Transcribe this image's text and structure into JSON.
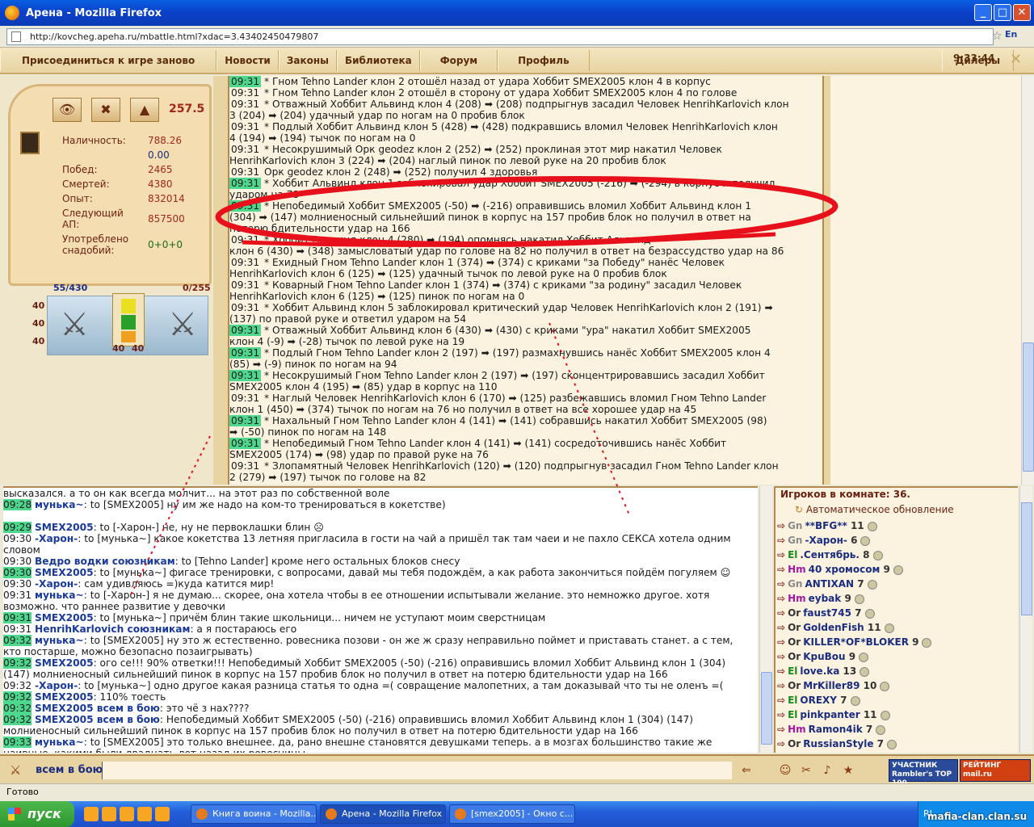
{
  "window": {
    "title": "Арена - Mozilla Firefox",
    "url": "http://kovcheg.apeha.ru/mbattle.html?xdac=3.43402450479807",
    "lang": "En"
  },
  "menu": {
    "items": [
      "Присоединиться к игре заново",
      "Новости",
      "Законы",
      "Библиотека",
      "Форум",
      "Профиль",
      "Дилеры"
    ],
    "time": "9:33:44"
  },
  "stats": {
    "score": "257.5",
    "rows": [
      {
        "label": "Наличность:",
        "value": "788.26"
      },
      {
        "label": "",
        "value": "0.00"
      },
      {
        "label": "Побед:",
        "value": "2465"
      },
      {
        "label": "Смертей:",
        "value": "4380"
      },
      {
        "label": "Опыт:",
        "value": "832014"
      },
      {
        "label": "Следующий АП:",
        "value": "857500"
      },
      {
        "label": "Употреблено снадобий:",
        "value": "0+0+0"
      }
    ],
    "hp": "55/430",
    "mana": "0/255",
    "levels": [
      "40",
      "40",
      "40"
    ],
    "gear_counts": [
      "40",
      "40"
    ]
  },
  "combat_log": [
    {
      "t": "09:31",
      "hl": true,
      "text": "* Гном Tehno Lander клон 2 отошёл назад от удара Хоббит SMEX2005 клон 4 в корпус"
    },
    {
      "t": "09:31",
      "hl": false,
      "text": "* Гном Tehno Lander клон 2 отошёл в сторону от удара Хоббит SMEX2005 клон 4 по голове"
    },
    {
      "t": "09:31",
      "hl": false,
      "text": "* Отважный Хоббит Альвинд клон 4 (208) ➡ (208) подпрыгнув засадил Человек HenrihKarlovich клон"
    },
    {
      "t": "",
      "hl": false,
      "text": "3 (204) ➡ (204) удачный удар по ногам на 0 пробив блок"
    },
    {
      "t": "09:31",
      "hl": false,
      "text": "* Подлый Хоббит Альвинд клон 5 (428) ➡ (428) подкравшись вломил Человек HenrihKarlovich клон"
    },
    {
      "t": "",
      "hl": false,
      "text": "4 (194) ➡ (194) тычок по ногам на 0"
    },
    {
      "t": "09:31",
      "hl": false,
      "text": "* Несокрушимый Орк geodez клон 2 (252) ➡ (252) проклиная этот мир накатил Человек"
    },
    {
      "t": "",
      "hl": false,
      "text": "HenrihKarlovich клон 3 (224) ➡ (204) наглый пинок по левой руке на 20 пробив блок"
    },
    {
      "t": "09:31",
      "hl": false,
      "text": "Орк geodez клон 2 (248) ➡ (252) получил 4 здоровья"
    },
    {
      "t": "09:31",
      "hl": true,
      "text": "* Хоббит Альвинд клон 1 заблокировал удар Хоббит SMEX2005 (-216) ➡ (-294) в корпус и получил"
    },
    {
      "t": "",
      "hl": false,
      "text": "ударом на 78"
    },
    {
      "t": "09:31",
      "hl": true,
      "text": "* Непобедимый Хоббит SMEX2005 (-50) ➡ (-216) оправившись вломил Хоббит Альвинд клон 1"
    },
    {
      "t": "",
      "hl": false,
      "text": "(304) ➡ (147) молниеносный сильнейший пинок в корпус на 157 пробив блок но получил в ответ на"
    },
    {
      "t": "",
      "hl": false,
      "text": "потерю бдительности удар на 166"
    },
    {
      "t": "09:31",
      "hl": false,
      "text": "* Хоббит Альвинд клон 4 (280) ➡ (194) опомнясь накатил Хоббит Альвинд"
    },
    {
      "t": "",
      "hl": false,
      "text": "клон 6 (430) ➡ (348) замысловатый удар по голове на 82 но получил в ответ на безрассудство удар на 86"
    },
    {
      "t": "09:31",
      "hl": false,
      "text": "* Ехидный Гном Tehno Lander клон 1 (374) ➡ (374) с криками \"за Победу\" нанёс Человек"
    },
    {
      "t": "",
      "hl": false,
      "text": "HenrihKarlovich клон 6 (125) ➡ (125) удачный тычок по левой руке на 0 пробив блок"
    },
    {
      "t": "09:31",
      "hl": false,
      "text": "* Коварный Гном Tehno Lander клон 1 (374) ➡ (374) с криками \"за родину\" засадил Человек"
    },
    {
      "t": "",
      "hl": false,
      "text": "HenrihKarlovich клон 6 (125) ➡ (125) пинок по ногам на 0"
    },
    {
      "t": "09:31",
      "hl": false,
      "text": "* Хоббит Альвинд клон 5 заблокировал критический удар Человек HenrihKarlovich клон 2 (191) ➡"
    },
    {
      "t": "",
      "hl": false,
      "text": "(137) по правой руке и ответил ударом на 54"
    },
    {
      "t": "09:31",
      "hl": true,
      "text": "* Отважный Хоббит Альвинд клон 6 (430) ➡ (430) с криками \"ура\" накатил Хоббит SMEX2005"
    },
    {
      "t": "",
      "hl": false,
      "text": "клон 4 (-9) ➡ (-28) тычок по левой руке на 19"
    },
    {
      "t": "09:31",
      "hl": true,
      "text": "* Подлый Гном Tehno Lander клон 2 (197) ➡ (197) размахнувшись нанёс Хоббит SMEX2005 клон 4"
    },
    {
      "t": "",
      "hl": false,
      "text": "(85) ➡ (-9) пинок по ногам на 94"
    },
    {
      "t": "09:31",
      "hl": true,
      "text": "* Несокрушимый Гном Tehno Lander клон 2 (197) ➡ (197) сконцентрировавшись засадил Хоббит"
    },
    {
      "t": "",
      "hl": false,
      "text": "SMEX2005 клон 4 (195) ➡ (85) удар в корпус на 110"
    },
    {
      "t": "09:31",
      "hl": false,
      "text": "* Наглый Человек HenrihKarlovich клон 6 (170) ➡ (125) разбежавшись вломил Гном Tehno Lander"
    },
    {
      "t": "",
      "hl": false,
      "text": "клон 1 (450) ➡ (374) тычок по ногам на 76 но получил в ответ на все хорошее удар на 45"
    },
    {
      "t": "09:31",
      "hl": true,
      "text": "* Нахальный Гном Tehno Lander клон 4 (141) ➡ (141) собравшись накатил Хоббит SMEX2005 (98)"
    },
    {
      "t": "",
      "hl": false,
      "text": "➡ (-50) пинок по ногам на 148"
    },
    {
      "t": "09:31",
      "hl": true,
      "text": "* Непобедимый Гном Tehno Lander клон 4 (141) ➡ (141) сосредоточившись нанёс Хоббит"
    },
    {
      "t": "",
      "hl": false,
      "text": "SMEX2005 (174) ➡ (98) удар по правой руке на 76"
    },
    {
      "t": "09:31",
      "hl": false,
      "text": "* Злопамятный Человек HenrihKarlovich (120) ➡ (120) подпрыгнув засадил Гном Tehno Lander клон"
    },
    {
      "t": "",
      "hl": false,
      "text": "2 (279) ➡ (197) тычок по голове на 82"
    }
  ],
  "chat": [
    {
      "t": "",
      "hl": false,
      "nick": "",
      "text": "высказался. а то он как всегда молчит... на этот раз по собственной воле"
    },
    {
      "t": "09:28",
      "hl": true,
      "nick": "мунька~",
      "text": ": to [SMEX2005] ну им же надо на ком-то тренироваться в кокетстве)"
    },
    {
      "t": "",
      "hl": false,
      "nick": "",
      "text": ""
    },
    {
      "t": "09:29",
      "hl": true,
      "nick": "SMEX2005",
      "text": ": to [-Харон-] не, ну не первоклашки блин ☹"
    },
    {
      "t": "09:30",
      "hl": false,
      "nick": "-Харон-",
      "text": ": to [мунька~] какое кокетства 13 летняя пригласила в гости на чай а пришёл так там чаеи и не пахло СЕКСА хотела одним"
    },
    {
      "t": "",
      "hl": false,
      "nick": "",
      "text": "словом"
    },
    {
      "t": "09:30",
      "hl": false,
      "nick": "Ведро водки союзникам",
      "text": ": to [Tehno Lander] кроме него остальных блоков снесу"
    },
    {
      "t": "09:30",
      "hl": true,
      "nick": "SMEX2005",
      "text": ": to [мунька~] фигасе тренировки, с вопросами, давай мы тебя подождём, а как работа закончиться пойдём погуляем ☺"
    },
    {
      "t": "09:30",
      "hl": false,
      "nick": "-Харон-",
      "text": ": сам удивляюсь =)куда катится мир!"
    },
    {
      "t": "09:31",
      "hl": false,
      "nick": "мунька~",
      "text": ": to [-Харон-] я не думаю... скорее, она хотела чтобы в ее отношении испытывали желание. это немножко другое. хотя"
    },
    {
      "t": "",
      "hl": false,
      "nick": "",
      "text": "возможно. что раннее развитие у девочки"
    },
    {
      "t": "09:31",
      "hl": true,
      "nick": "SMEX2005",
      "text": ": to [мунька~] причём блин такие школьници... ничем не уступают моим сверстницам"
    },
    {
      "t": "09:31",
      "hl": false,
      "nick": "HenrihKarlovich союзникам",
      "text": ": а я постараюсь его"
    },
    {
      "t": "09:32",
      "hl": true,
      "nick": "мунька~",
      "text": ": to [SMEX2005] ну это ж естественно. ровесника позови - он же ж сразу неправильно поймет и приставать станет. а с тем,"
    },
    {
      "t": "",
      "hl": false,
      "nick": "",
      "text": "кто постарше, можно безопасно позаигрывать)"
    },
    {
      "t": "09:32",
      "hl": true,
      "nick": "SMEX2005",
      "text": ": ого се!!! 90% ответки!!! Непобедимый Хоббит SMEX2005 (-50) (-216) оправившись вломил Хоббит Альвинд клон 1 (304)"
    },
    {
      "t": "",
      "hl": false,
      "nick": "",
      "text": "(147) молниеносный сильнейший пинок в корпус на 157 пробив блок но получил в ответ на потерю бдительности удар на 166"
    },
    {
      "t": "09:32",
      "hl": false,
      "nick": "-Харон-",
      "text": ": to [мунька~] одно другое какая разница статья то одна =( совращение малопетних, а там доказывай что ты не оленъ =("
    },
    {
      "t": "09:32",
      "hl": true,
      "nick": "SMEX2005",
      "text": ": 110% тоесть"
    },
    {
      "t": "09:32",
      "hl": true,
      "nick": "SMEX2005 всем в бою",
      "text": ": это чё з нах????"
    },
    {
      "t": "09:32",
      "hl": true,
      "nick": "SMEX2005 всем в бою",
      "text": ": Непобедимый Хоббит SMEX2005 (-50) (-216) оправившись вломил Хоббит Альвинд клон 1 (304) (147)"
    },
    {
      "t": "",
      "hl": false,
      "nick": "",
      "text": "молниеносный сильнейший пинок в корпус на 157 пробив блок но получил в ответ на потерю бдительности удар на 166"
    },
    {
      "t": "09:33",
      "hl": true,
      "nick": "мунька~",
      "text": ": to [SMEX2005] это только внешнее. да, рано внешне становятся девушками теперь. а в мозгах большинство такие же"
    },
    {
      "t": "",
      "hl": false,
      "nick": "",
      "text": "наивные, какими были двадцать лет назад их ровесницы"
    }
  ],
  "players": {
    "header": "Игроков в комнате: 36.",
    "auto_update": "Автоматическое обновление",
    "list": [
      {
        "race": "Gn",
        "name": "**BFG**",
        "level": "11"
      },
      {
        "race": "Gn",
        "name": "-Харон-",
        "level": "6"
      },
      {
        "race": "El",
        "name": ".Сентябрь.",
        "level": "8"
      },
      {
        "race": "Hm",
        "name": "40 хромосом",
        "level": "9"
      },
      {
        "race": "Gn",
        "name": "ANTIXAN",
        "level": "7"
      },
      {
        "race": "Hm",
        "name": "eybak",
        "level": "9"
      },
      {
        "race": "Or",
        "name": "faust745",
        "level": "7"
      },
      {
        "race": "Or",
        "name": "GoldenFish",
        "level": "11"
      },
      {
        "race": "Or",
        "name": "KILLER*OF*BLOKER",
        "level": "9"
      },
      {
        "race": "Or",
        "name": "KpuBou",
        "level": "9"
      },
      {
        "race": "El",
        "name": "love.ka",
        "level": "13"
      },
      {
        "race": "Or",
        "name": "MrKiller89",
        "level": "10"
      },
      {
        "race": "El",
        "name": "OREXY",
        "level": "7"
      },
      {
        "race": "El",
        "name": "pinkpanter",
        "level": "11"
      },
      {
        "race": "Hm",
        "name": "Ramon4ik",
        "level": "7"
      },
      {
        "race": "Or",
        "name": "RussianStyle",
        "level": "7"
      }
    ]
  },
  "input": {
    "target": "всем в бою",
    "badge1": "УЧАСТНИК Rambler's TOP 100",
    "badge2": "РЕЙТИНГ mail.ru"
  },
  "status": "Готово",
  "taskbar": {
    "start": "пуск",
    "tasks": [
      "Книга воина - Mozilla...",
      "Арена - Mozilla Firefox",
      "[smex2005] - Окно с..."
    ],
    "tray": "RL"
  },
  "watermark": "mafia-clan.clan.su"
}
